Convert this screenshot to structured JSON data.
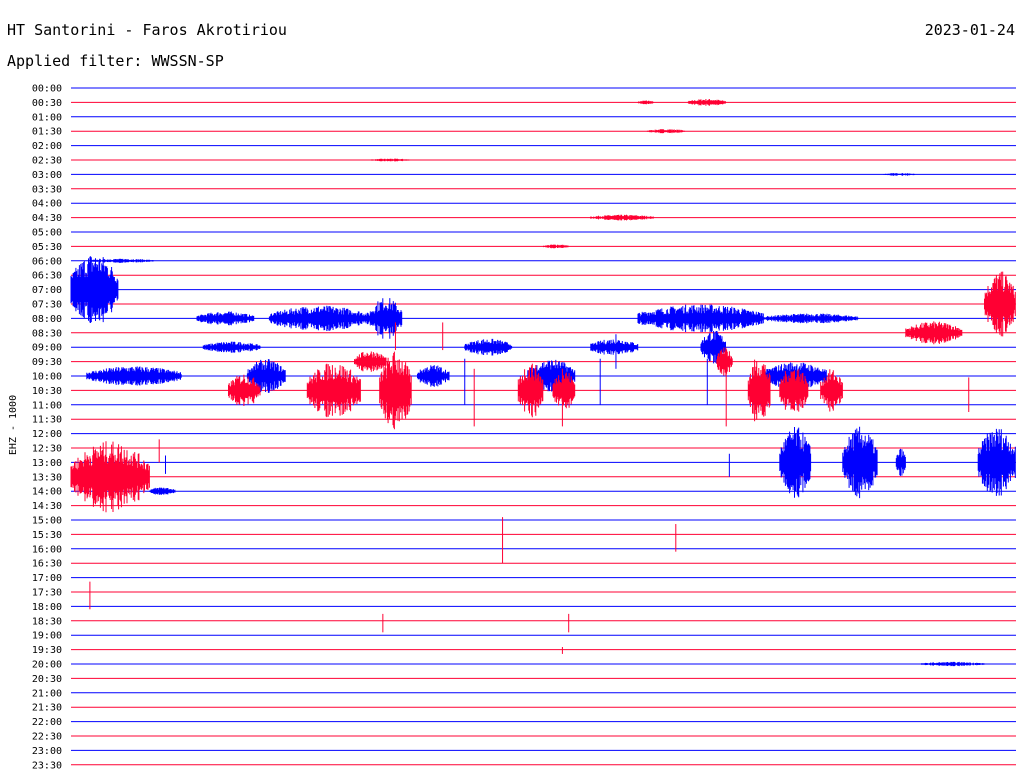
{
  "header": {
    "station": "HT Santorini - Faros Akrotiriou",
    "filter": "Applied filter: WWSSN-SP",
    "date": "2023-01-24"
  },
  "colors": {
    "blue": "#0000ff",
    "red": "#ff0033"
  },
  "chart_data": {
    "type": "line",
    "title": "HT Santorini - Faros Akrotiriou",
    "subtitle": "Applied filter: WWSSN-SP",
    "ylabel": "EHZ - 1000",
    "date": "2023-01-24",
    "row_labels": [
      "00:00",
      "00:30",
      "01:00",
      "01:30",
      "02:00",
      "02:30",
      "03:00",
      "03:30",
      "04:00",
      "04:30",
      "05:00",
      "05:30",
      "06:00",
      "06:30",
      "07:00",
      "07:30",
      "08:00",
      "08:30",
      "09:00",
      "09:30",
      "10:00",
      "10:30",
      "11:00",
      "11:30",
      "12:00",
      "12:30",
      "13:00",
      "13:30",
      "14:00",
      "14:30",
      "15:00",
      "15:30",
      "16:00",
      "16:30",
      "17:00",
      "17:30",
      "18:00",
      "18:30",
      "19:00",
      "19:30",
      "20:00",
      "20:30",
      "21:00",
      "21:30",
      "22:00",
      "22:30",
      "23:00",
      "23:30"
    ],
    "row_colors": [
      "blue",
      "red"
    ],
    "x_unit": "minutes within row",
    "xlim": [
      0,
      30
    ],
    "bursts": [
      {
        "row": 1,
        "start": 18.0,
        "end": 18.5,
        "amp": 0.15
      },
      {
        "row": 1,
        "start": 19.6,
        "end": 20.8,
        "amp": 0.25
      },
      {
        "row": 3,
        "start": 18.3,
        "end": 19.5,
        "amp": 0.15
      },
      {
        "row": 5,
        "start": 9.5,
        "end": 10.8,
        "amp": 0.1
      },
      {
        "row": 6,
        "start": 25.8,
        "end": 26.8,
        "amp": 0.1
      },
      {
        "row": 9,
        "start": 16.5,
        "end": 18.5,
        "amp": 0.2
      },
      {
        "row": 11,
        "start": 15.0,
        "end": 15.8,
        "amp": 0.15
      },
      {
        "row": 12,
        "start": 0.6,
        "end": 2.6,
        "amp": 0.15
      },
      {
        "row": 14,
        "start": 0.0,
        "end": 1.5,
        "amp": 2.6
      },
      {
        "row": 15,
        "start": 29.0,
        "end": 30.0,
        "amp": 2.3
      },
      {
        "row": 16,
        "start": 4.0,
        "end": 5.8,
        "amp": 0.5
      },
      {
        "row": 16,
        "start": 6.3,
        "end": 9.5,
        "amp": 0.9
      },
      {
        "row": 16,
        "start": 9.5,
        "end": 10.5,
        "amp": 1.5
      },
      {
        "row": 16,
        "start": 18.0,
        "end": 22.0,
        "amp": 1.0
      },
      {
        "row": 16,
        "start": 22.0,
        "end": 25.0,
        "amp": 0.35
      },
      {
        "row": 17,
        "start": 26.5,
        "end": 28.3,
        "amp": 0.8
      },
      {
        "row": 18,
        "start": 4.2,
        "end": 6.0,
        "amp": 0.4
      },
      {
        "row": 18,
        "start": 12.5,
        "end": 14.0,
        "amp": 0.6
      },
      {
        "row": 18,
        "start": 16.5,
        "end": 18.0,
        "amp": 0.6
      },
      {
        "row": 18,
        "start": 20.0,
        "end": 20.8,
        "amp": 1.2
      },
      {
        "row": 19,
        "start": 9.0,
        "end": 10.0,
        "amp": 0.8
      },
      {
        "row": 19,
        "start": 20.5,
        "end": 21.0,
        "amp": 1.0
      },
      {
        "row": 20,
        "start": 0.5,
        "end": 3.5,
        "amp": 0.7
      },
      {
        "row": 20,
        "start": 5.6,
        "end": 6.8,
        "amp": 1.2
      },
      {
        "row": 20,
        "start": 11.0,
        "end": 12.0,
        "amp": 0.8
      },
      {
        "row": 20,
        "start": 14.5,
        "end": 16.0,
        "amp": 1.2
      },
      {
        "row": 20,
        "start": 22.0,
        "end": 24.0,
        "amp": 1.0
      },
      {
        "row": 21,
        "start": 5.0,
        "end": 6.0,
        "amp": 1.2
      },
      {
        "row": 21,
        "start": 7.5,
        "end": 9.2,
        "amp": 2.0
      },
      {
        "row": 21,
        "start": 9.8,
        "end": 10.8,
        "amp": 2.8
      },
      {
        "row": 21,
        "start": 14.2,
        "end": 15.0,
        "amp": 2.0
      },
      {
        "row": 21,
        "start": 15.3,
        "end": 16.0,
        "amp": 1.5
      },
      {
        "row": 21,
        "start": 21.5,
        "end": 22.2,
        "amp": 2.5
      },
      {
        "row": 21,
        "start": 22.5,
        "end": 23.4,
        "amp": 1.8
      },
      {
        "row": 21,
        "start": 23.8,
        "end": 24.5,
        "amp": 1.5
      },
      {
        "row": 26,
        "start": 22.5,
        "end": 23.5,
        "amp": 2.5
      },
      {
        "row": 26,
        "start": 24.5,
        "end": 25.6,
        "amp": 2.5
      },
      {
        "row": 26,
        "start": 26.2,
        "end": 26.5,
        "amp": 1.0
      },
      {
        "row": 26,
        "start": 28.8,
        "end": 30.0,
        "amp": 2.5
      },
      {
        "row": 27,
        "start": 0.0,
        "end": 2.5,
        "amp": 2.5
      },
      {
        "row": 28,
        "start": 2.5,
        "end": 3.3,
        "amp": 0.3
      },
      {
        "row": 40,
        "start": 27.0,
        "end": 29.0,
        "amp": 0.15
      }
    ],
    "spikes": [
      {
        "row": 17,
        "t": 10.3,
        "amp": 1.2
      },
      {
        "row": 17,
        "t": 11.8,
        "amp": 1.2
      },
      {
        "row": 18,
        "t": 17.3,
        "amp": 1.5
      },
      {
        "row": 20,
        "t": 12.5,
        "amp": 2.0
      },
      {
        "row": 20,
        "t": 16.8,
        "amp": 2.0
      },
      {
        "row": 20,
        "t": 20.2,
        "amp": 2.0
      },
      {
        "row": 21,
        "t": 12.8,
        "amp": 2.5
      },
      {
        "row": 21,
        "t": 15.6,
        "amp": 2.5
      },
      {
        "row": 21,
        "t": 20.8,
        "amp": 2.5
      },
      {
        "row": 21,
        "t": 28.5,
        "amp": 1.5
      },
      {
        "row": 25,
        "t": 2.8,
        "amp": 1.0
      },
      {
        "row": 26,
        "t": 3.0,
        "amp": 0.8
      },
      {
        "row": 26,
        "t": 20.9,
        "amp": 1.0
      },
      {
        "row": 31,
        "t": 13.7,
        "amp": 2.0
      },
      {
        "row": 31,
        "t": 19.2,
        "amp": 1.2
      },
      {
        "row": 35,
        "t": 0.6,
        "amp": 1.2
      },
      {
        "row": 37,
        "t": 9.9,
        "amp": 0.8
      },
      {
        "row": 37,
        "t": 15.8,
        "amp": 0.8
      },
      {
        "row": 39,
        "t": 15.6,
        "amp": 0.3
      }
    ],
    "grid": false,
    "legend": "none"
  }
}
